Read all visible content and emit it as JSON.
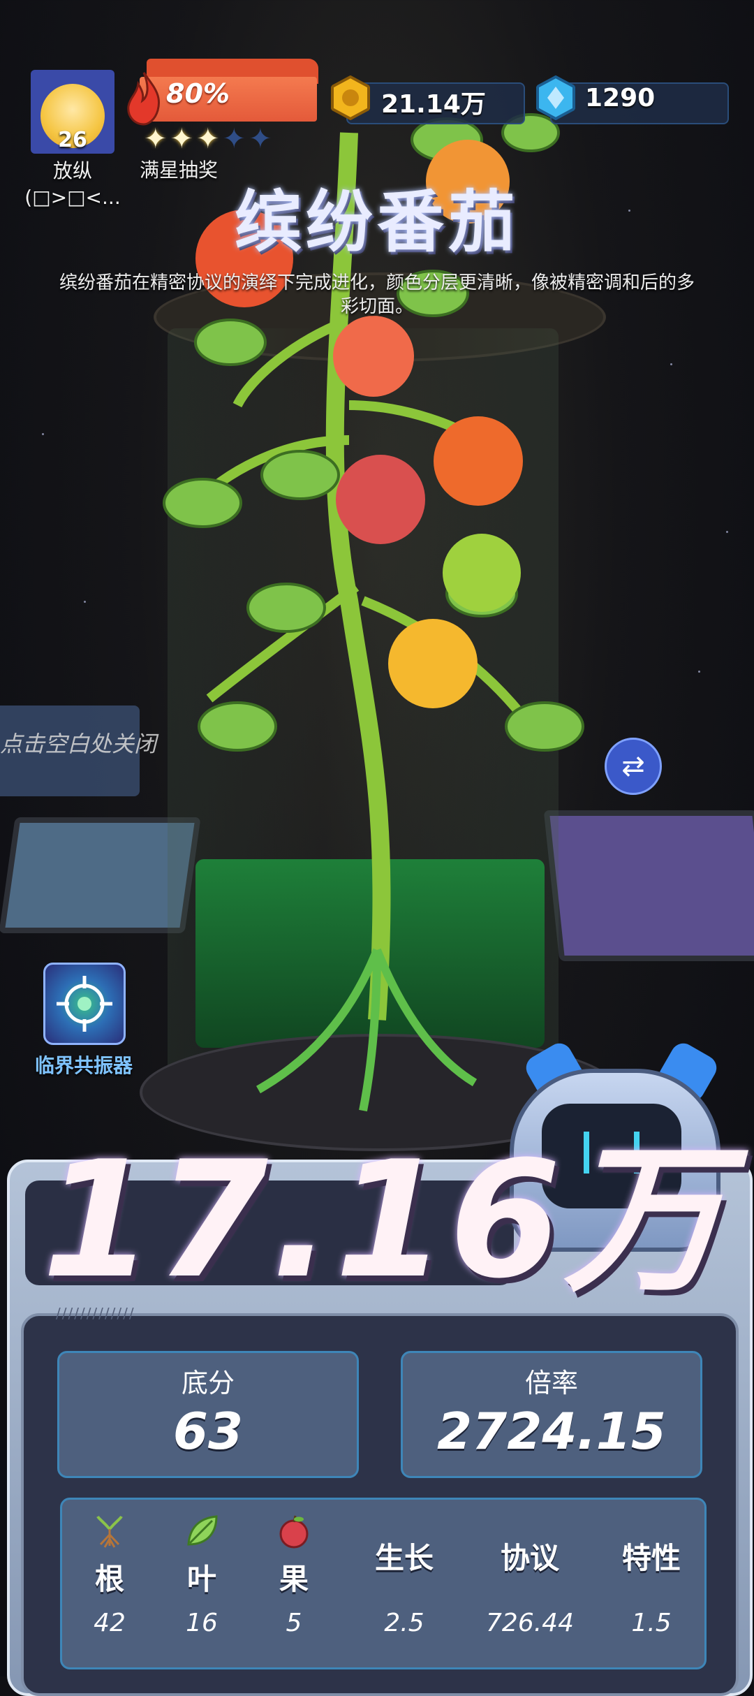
{
  "hud": {
    "player": {
      "level": "26",
      "nickname": "放纵(□>□<..."
    },
    "energy": {
      "percent": "80%",
      "stars_filled": 3,
      "stars_total": 5,
      "star_label": "满星抽奖"
    },
    "coins": "21.14万",
    "gems": "1290"
  },
  "plant": {
    "title": "缤纷番茄",
    "description": "缤纷番茄在精密协议的演绎下完成进化，颜色分层更清晰，像被精密调和后的多彩切面。"
  },
  "hint": {
    "close": "点击空白处关闭"
  },
  "resonator": {
    "label": "临界共振器"
  },
  "score": {
    "total": "17.16万"
  },
  "stats": {
    "base": {
      "label": "底分",
      "value": "63"
    },
    "multiplier": {
      "label": "倍率",
      "value": "2724.15"
    }
  },
  "attributes": [
    {
      "name": "根",
      "value": "42",
      "icon": "root-icon"
    },
    {
      "name": "叶",
      "value": "16",
      "icon": "leaf-icon"
    },
    {
      "name": "果",
      "value": "5",
      "icon": "fruit-icon"
    },
    {
      "name": "生长",
      "value": "2.5"
    },
    {
      "name": "协议",
      "value": "726.44"
    },
    {
      "name": "特性",
      "value": "1.5"
    }
  ],
  "colors": {
    "energy": "#e45a3a",
    "accent_blue": "#3b59c9",
    "panel": "#4e607e",
    "border": "#3e86b8"
  }
}
